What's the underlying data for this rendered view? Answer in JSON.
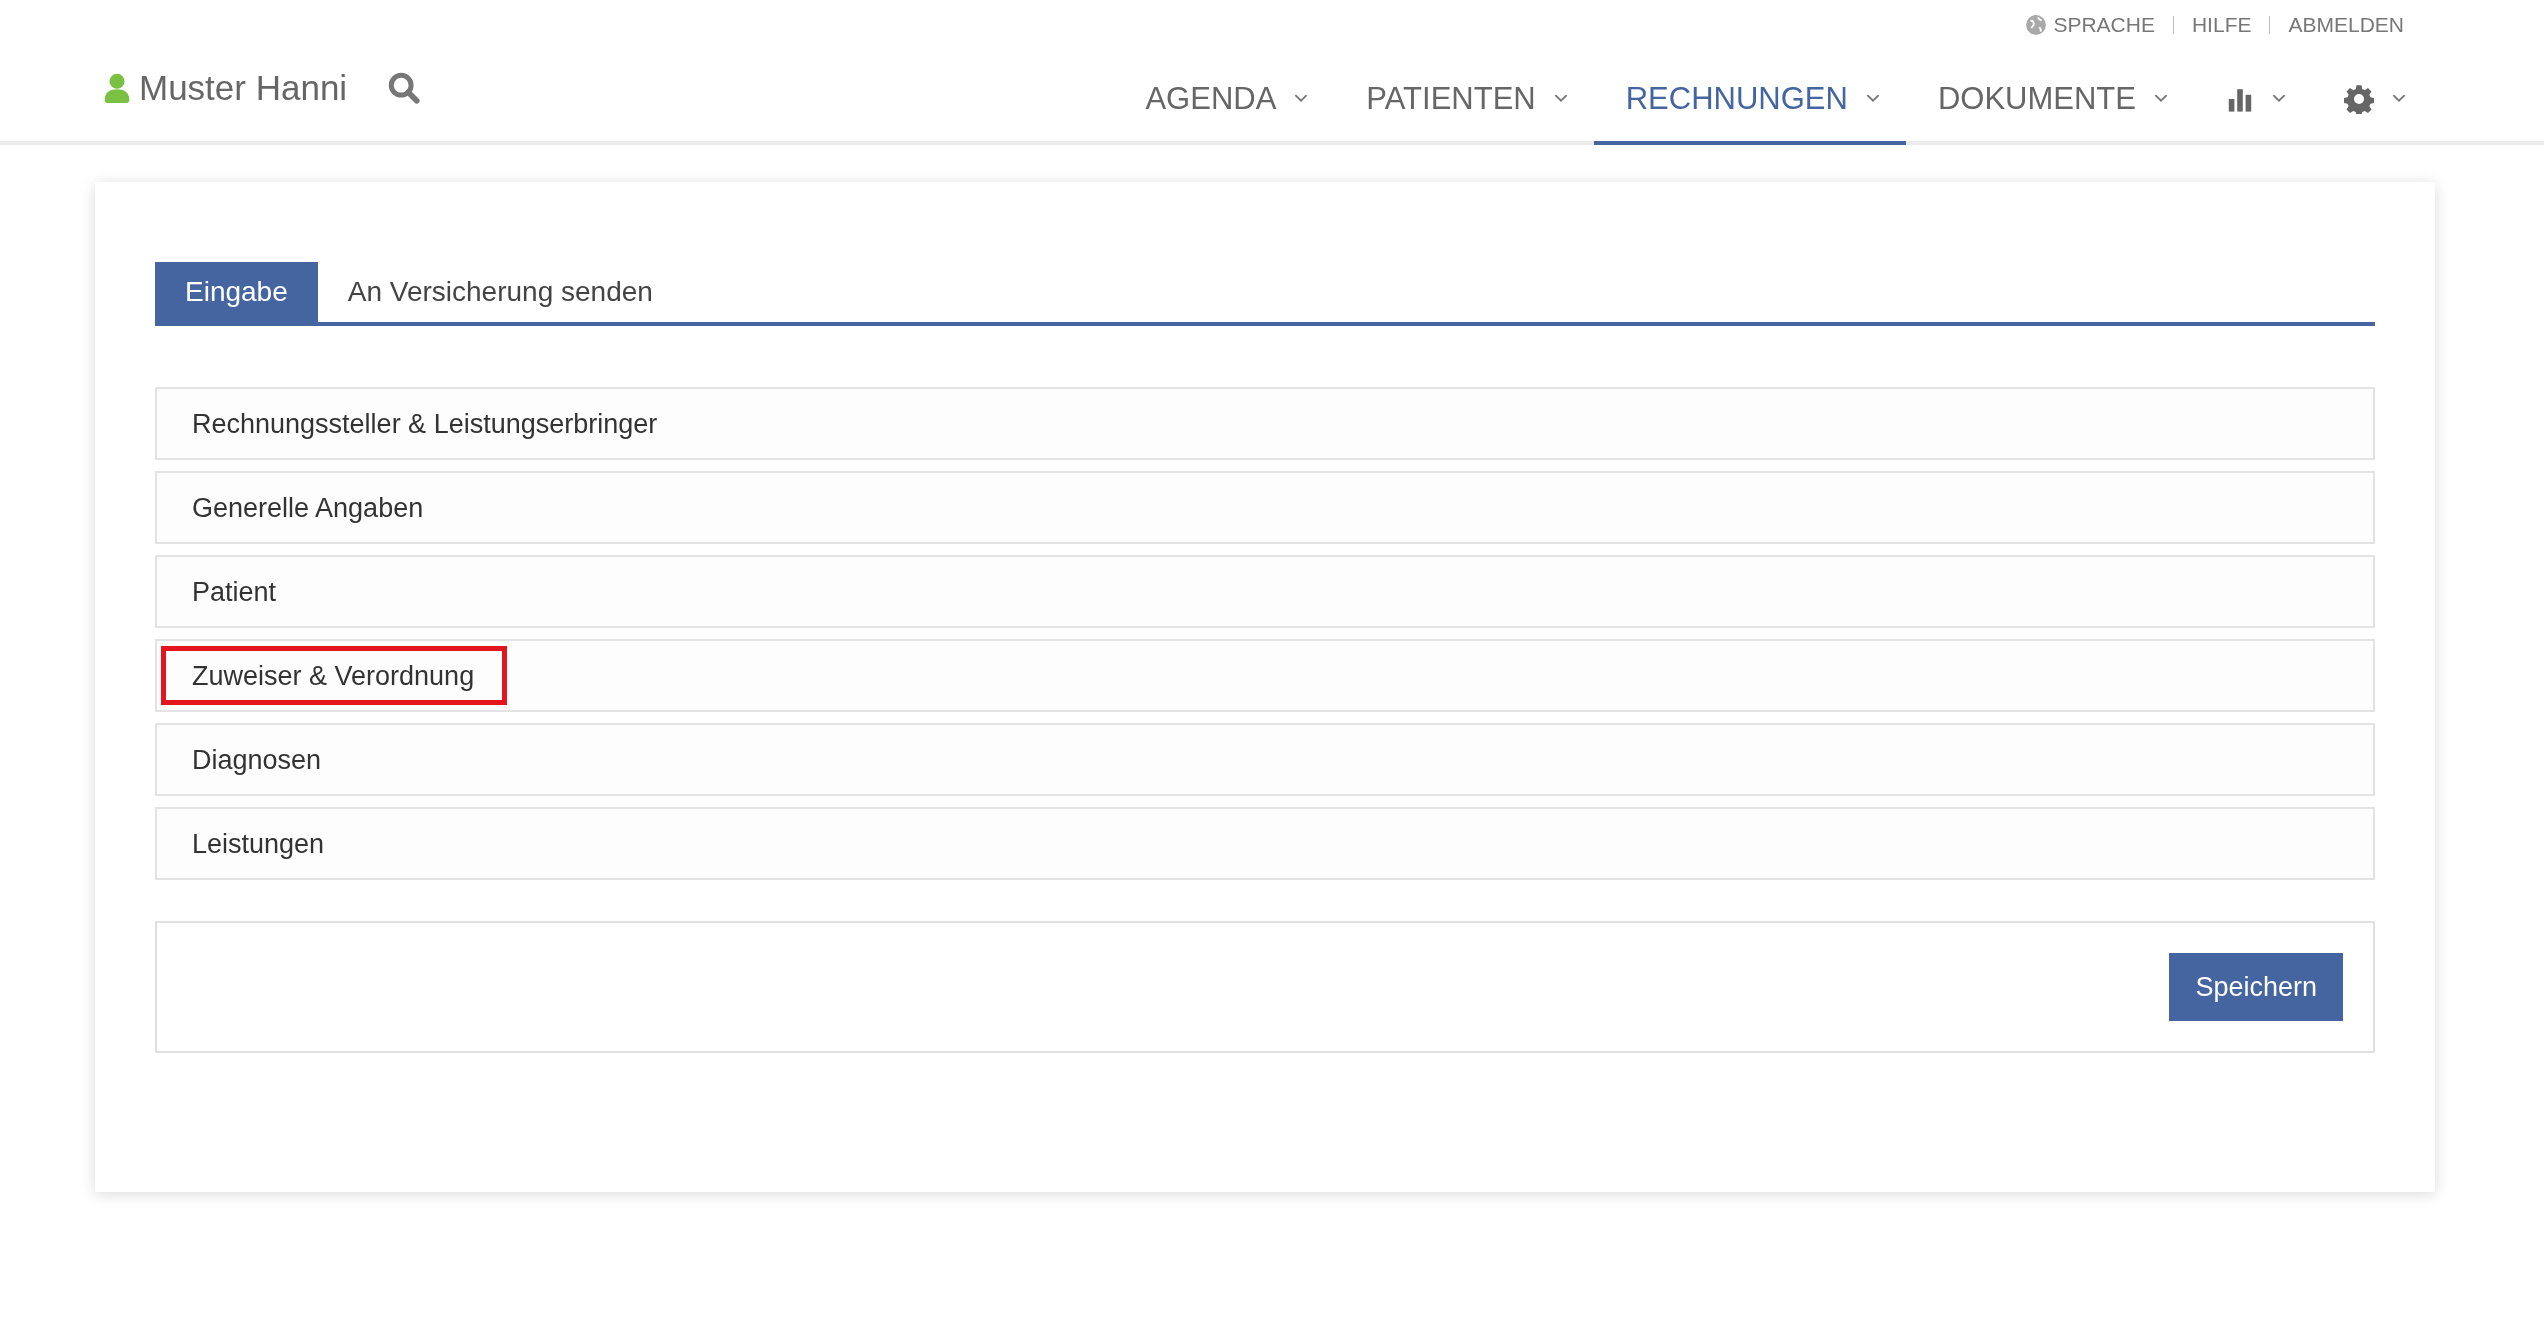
{
  "top_links": [
    {
      "label": "SPRACHE"
    },
    {
      "label": "HILFE"
    },
    {
      "label": "ABMELDEN"
    }
  ],
  "user": {
    "name": "Muster Hanni"
  },
  "nav": [
    {
      "kind": "text",
      "label": "AGENDA",
      "selected": false
    },
    {
      "kind": "text",
      "label": "PATIENTEN",
      "selected": false
    },
    {
      "kind": "text",
      "label": "RECHNUNGEN",
      "selected": true
    },
    {
      "kind": "text",
      "label": "DOKUMENTE",
      "selected": false
    },
    {
      "kind": "chart",
      "selected": false
    },
    {
      "kind": "gear",
      "selected": false
    }
  ],
  "tabs": [
    {
      "label": "Eingabe",
      "selected": true
    },
    {
      "label": "An Versicherung senden",
      "selected": false
    }
  ],
  "sections": [
    {
      "label": "Rechnungssteller & Leistungserbringer",
      "highlighted": false
    },
    {
      "label": "Generelle Angaben",
      "highlighted": false
    },
    {
      "label": "Patient",
      "highlighted": false
    },
    {
      "label": "Zuweiser & Verordnung",
      "highlighted": true
    },
    {
      "label": "Diagnosen",
      "highlighted": false
    },
    {
      "label": "Leistungen",
      "highlighted": false
    }
  ],
  "save_button": "Speichern"
}
